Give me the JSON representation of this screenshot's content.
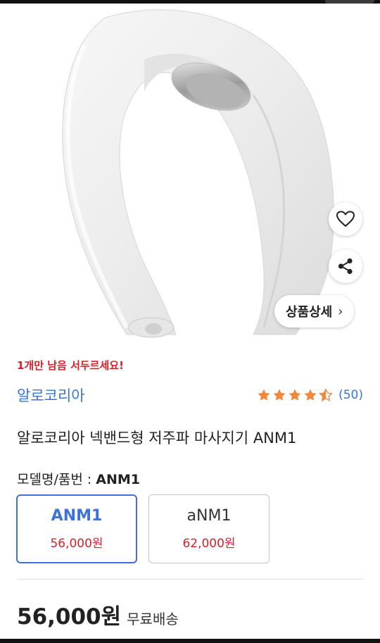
{
  "product": {
    "image_alt": "neckband massager",
    "stock_warning": "1개만 남음 서두르세요!",
    "brand": "알로코리아",
    "rating": 4.5,
    "review_count": "(50)",
    "title": "알로코리아 넥밴드형 저주파 마사지기 ANM1"
  },
  "actions": {
    "wishlist_icon": "heart-icon",
    "share_icon": "share-icon",
    "detail_label": "상품상세",
    "detail_chevron": "›"
  },
  "options": {
    "label_prefix": "모델명/품번 :",
    "label_value": "ANM1",
    "items": [
      {
        "name": "ANM1",
        "price": "56,000원",
        "selected": true
      },
      {
        "name": "aNM1",
        "price": "62,000원",
        "selected": false
      }
    ]
  },
  "price": {
    "amount": "56,000원",
    "shipping": "무료배송"
  },
  "colors": {
    "accent_blue": "#3b73d8",
    "price_red": "#d81f2a",
    "star_orange": "#f3873a"
  }
}
